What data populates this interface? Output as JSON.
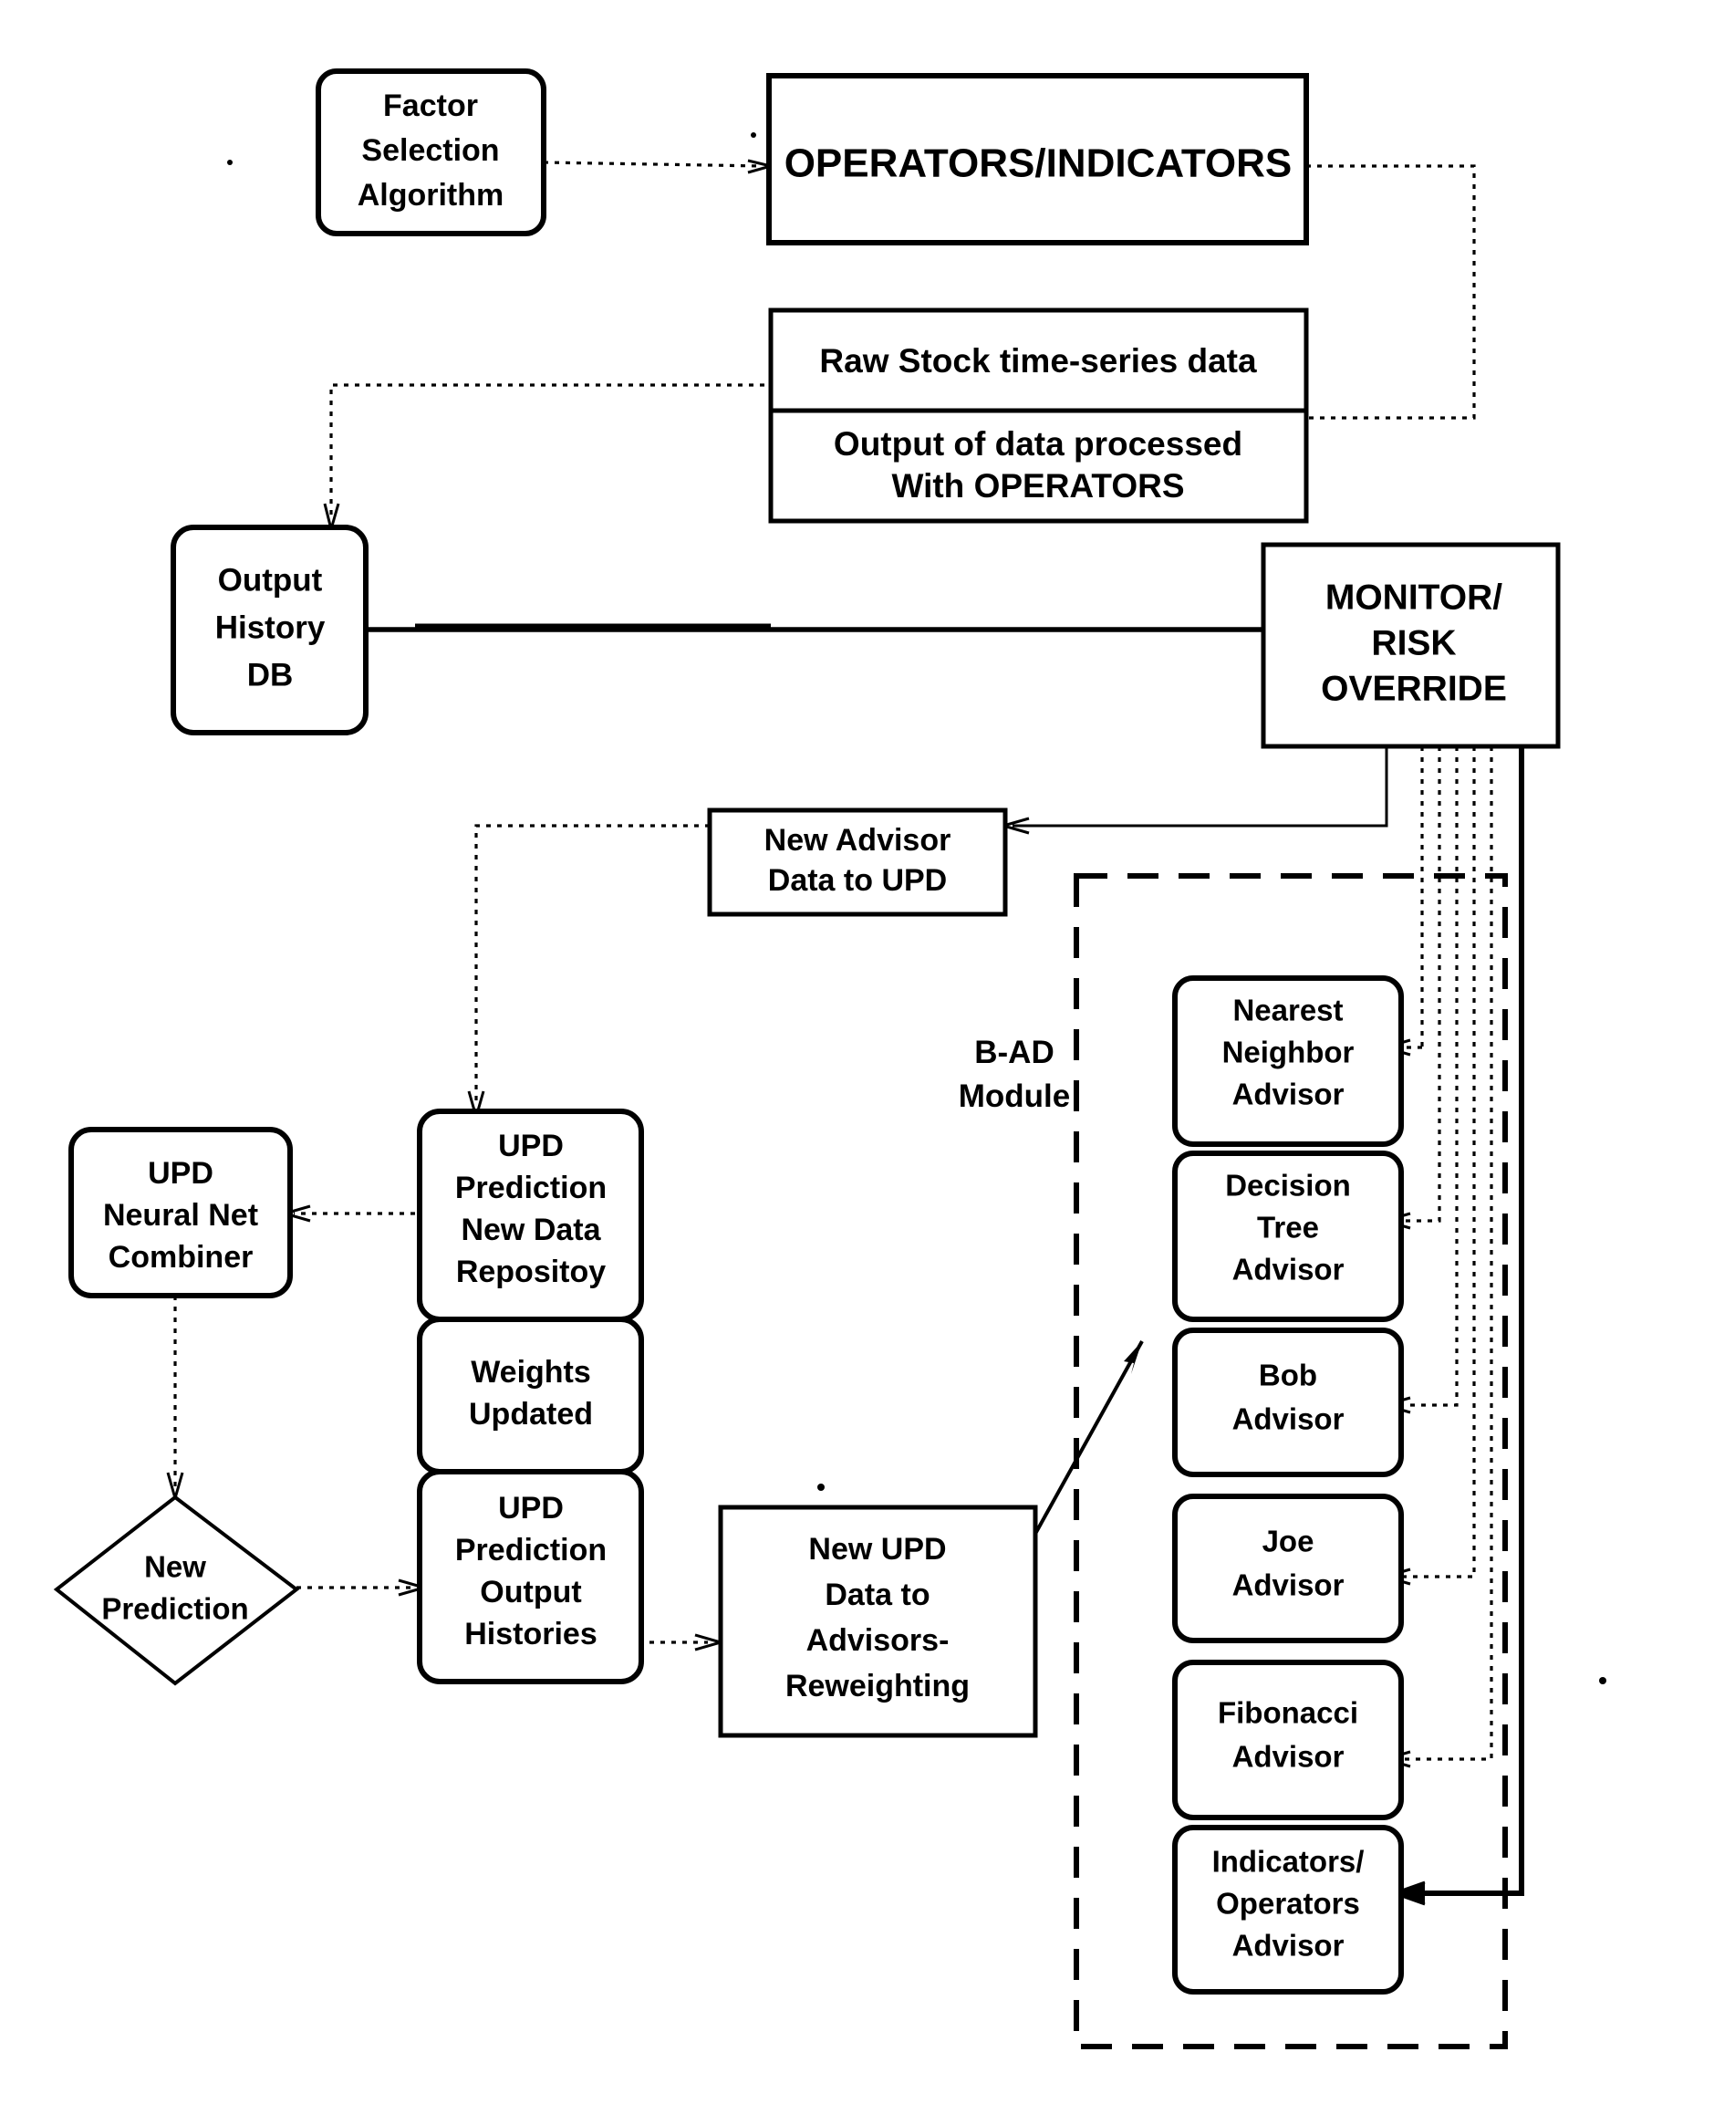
{
  "diagram": {
    "type": "flowchart",
    "title": "Stock prediction advisor system flowchart",
    "nodes": {
      "factor_selection": {
        "lines": [
          "Factor",
          "Selection",
          "Algorithm"
        ],
        "shape": "rounded-rect"
      },
      "operators_indicators": {
        "lines": [
          "OPERATORS/INDICATORS"
        ],
        "shape": "rect"
      },
      "raw_stock": {
        "lines": [
          "Raw Stock time-series data"
        ],
        "shape": "rect"
      },
      "output_processed": {
        "lines": [
          "Output of data processed",
          "With OPERATORS"
        ],
        "shape": "rect"
      },
      "output_history_db": {
        "lines": [
          "Output",
          "History",
          "DB"
        ],
        "shape": "rounded-rect"
      },
      "monitor_risk_override": {
        "lines": [
          "MONITOR/",
          "RISK",
          "OVERRIDE"
        ],
        "shape": "rect"
      },
      "new_advisor_data": {
        "lines": [
          "New Advisor",
          "Data to UPD"
        ],
        "shape": "rect"
      },
      "upd_neural_net": {
        "lines": [
          "UPD",
          "Neural Net",
          "Combiner"
        ],
        "shape": "rounded-rect"
      },
      "new_prediction": {
        "lines": [
          "New",
          "Prediction"
        ],
        "shape": "diamond"
      },
      "upd_prediction_repo": {
        "lines": [
          "UPD",
          "Prediction",
          "New Data",
          "Repositoy"
        ],
        "shape": "rounded-rect"
      },
      "weights_updated": {
        "lines": [
          "Weights",
          "Updated"
        ],
        "shape": "rounded-rect"
      },
      "upd_prediction_output": {
        "lines": [
          "UPD",
          "Prediction",
          "Output",
          "Histories"
        ],
        "shape": "rounded-rect"
      },
      "new_upd_data": {
        "lines": [
          "New UPD",
          "Data to",
          "Advisors-",
          "Reweighting"
        ],
        "shape": "rect"
      },
      "nearest_neighbor": {
        "lines": [
          "Nearest",
          "Neighbor",
          "Advisor"
        ],
        "shape": "rounded-rect"
      },
      "decision_tree": {
        "lines": [
          "Decision",
          "Tree",
          "Advisor"
        ],
        "shape": "rounded-rect"
      },
      "bob_advisor": {
        "lines": [
          "Bob",
          "Advisor"
        ],
        "shape": "rounded-rect"
      },
      "joe_advisor": {
        "lines": [
          "Joe",
          "Advisor"
        ],
        "shape": "rounded-rect"
      },
      "fibonacci_advisor": {
        "lines": [
          "Fibonacci",
          "Advisor"
        ],
        "shape": "rounded-rect"
      },
      "indicators_operators_advisor": {
        "lines": [
          "Indicators/",
          "Operators",
          "Advisor"
        ],
        "shape": "rounded-rect"
      }
    },
    "group_label": {
      "lines": [
        "B-AD",
        "Module"
      ]
    },
    "colors": {
      "stroke": "#000000",
      "fill": "#ffffff",
      "text": "#000000"
    }
  }
}
